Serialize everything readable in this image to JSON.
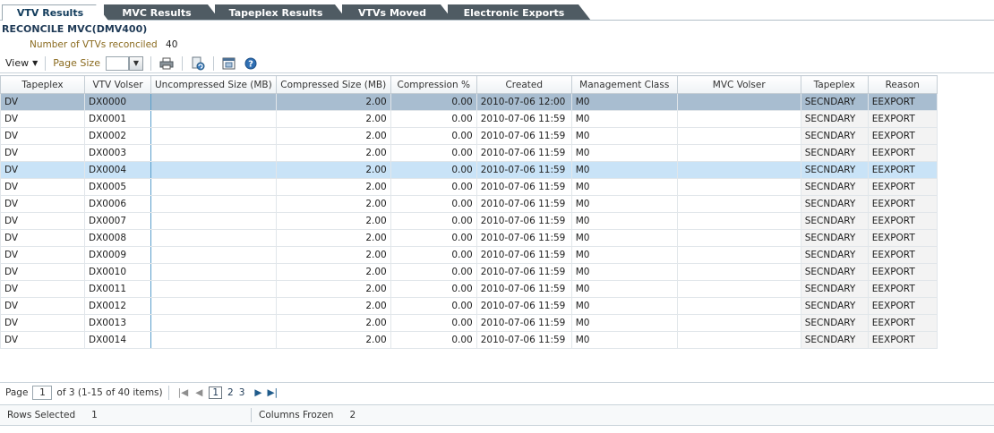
{
  "tabs": [
    {
      "label": "VTV Results",
      "active": true
    },
    {
      "label": "MVC Results",
      "active": false
    },
    {
      "label": "Tapeplex Results",
      "active": false
    },
    {
      "label": "VTVs Moved",
      "active": false
    },
    {
      "label": "Electronic Exports",
      "active": false
    }
  ],
  "panel": {
    "title": "RECONCILE MVC(DMV400)",
    "reconciled_label": "Number of VTVs reconciled",
    "reconciled_value": "40"
  },
  "toolbar": {
    "view_label": "View",
    "page_size_label": "Page Size",
    "icons": [
      "print-icon",
      "refresh-icon",
      "detach-icon",
      "help-icon"
    ]
  },
  "table": {
    "columns": [
      "Tapeplex",
      "VTV Volser",
      "Uncompressed Size (MB)",
      "Compressed Size (MB)",
      "Compression %",
      "Created",
      "Management Class",
      "MVC Volser",
      "Tapeplex",
      "Reason"
    ],
    "rows": [
      [
        "DV",
        "DX0000",
        "",
        "2.00",
        "0.00",
        "2010-07-06 12:00",
        "M0",
        "",
        "SECNDARY",
        "EEXPORT"
      ],
      [
        "DV",
        "DX0001",
        "",
        "2.00",
        "0.00",
        "2010-07-06 11:59",
        "M0",
        "",
        "SECNDARY",
        "EEXPORT"
      ],
      [
        "DV",
        "DX0002",
        "",
        "2.00",
        "0.00",
        "2010-07-06 11:59",
        "M0",
        "",
        "SECNDARY",
        "EEXPORT"
      ],
      [
        "DV",
        "DX0003",
        "",
        "2.00",
        "0.00",
        "2010-07-06 11:59",
        "M0",
        "",
        "SECNDARY",
        "EEXPORT"
      ],
      [
        "DV",
        "DX0004",
        "",
        "2.00",
        "0.00",
        "2010-07-06 11:59",
        "M0",
        "",
        "SECNDARY",
        "EEXPORT"
      ],
      [
        "DV",
        "DX0005",
        "",
        "2.00",
        "0.00",
        "2010-07-06 11:59",
        "M0",
        "",
        "SECNDARY",
        "EEXPORT"
      ],
      [
        "DV",
        "DX0006",
        "",
        "2.00",
        "0.00",
        "2010-07-06 11:59",
        "M0",
        "",
        "SECNDARY",
        "EEXPORT"
      ],
      [
        "DV",
        "DX0007",
        "",
        "2.00",
        "0.00",
        "2010-07-06 11:59",
        "M0",
        "",
        "SECNDARY",
        "EEXPORT"
      ],
      [
        "DV",
        "DX0008",
        "",
        "2.00",
        "0.00",
        "2010-07-06 11:59",
        "M0",
        "",
        "SECNDARY",
        "EEXPORT"
      ],
      [
        "DV",
        "DX0009",
        "",
        "2.00",
        "0.00",
        "2010-07-06 11:59",
        "M0",
        "",
        "SECNDARY",
        "EEXPORT"
      ],
      [
        "DV",
        "DX0010",
        "",
        "2.00",
        "0.00",
        "2010-07-06 11:59",
        "M0",
        "",
        "SECNDARY",
        "EEXPORT"
      ],
      [
        "DV",
        "DX0011",
        "",
        "2.00",
        "0.00",
        "2010-07-06 11:59",
        "M0",
        "",
        "SECNDARY",
        "EEXPORT"
      ],
      [
        "DV",
        "DX0012",
        "",
        "2.00",
        "0.00",
        "2010-07-06 11:59",
        "M0",
        "",
        "SECNDARY",
        "EEXPORT"
      ],
      [
        "DV",
        "DX0013",
        "",
        "2.00",
        "0.00",
        "2010-07-06 11:59",
        "M0",
        "",
        "SECNDARY",
        "EEXPORT"
      ],
      [
        "DV",
        "DX0014",
        "",
        "2.00",
        "0.00",
        "2010-07-06 11:59",
        "M0",
        "",
        "SECNDARY",
        "EEXPORT"
      ]
    ]
  },
  "pager": {
    "page_label": "Page",
    "current_page": "1",
    "of_text": "of 3 (1-15 of 40 items)",
    "pages": [
      "1",
      "2",
      "3"
    ]
  },
  "status": {
    "rows_selected_label": "Rows Selected",
    "rows_selected_value": "1",
    "columns_frozen_label": "Columns Frozen",
    "columns_frozen_value": "2"
  },
  "colors": {
    "tab_bg": "#4f5b63",
    "selected_row": "#a8bdd0",
    "hover_row": "#c9e3f7",
    "frozen_divider": "#5a9ecb"
  }
}
